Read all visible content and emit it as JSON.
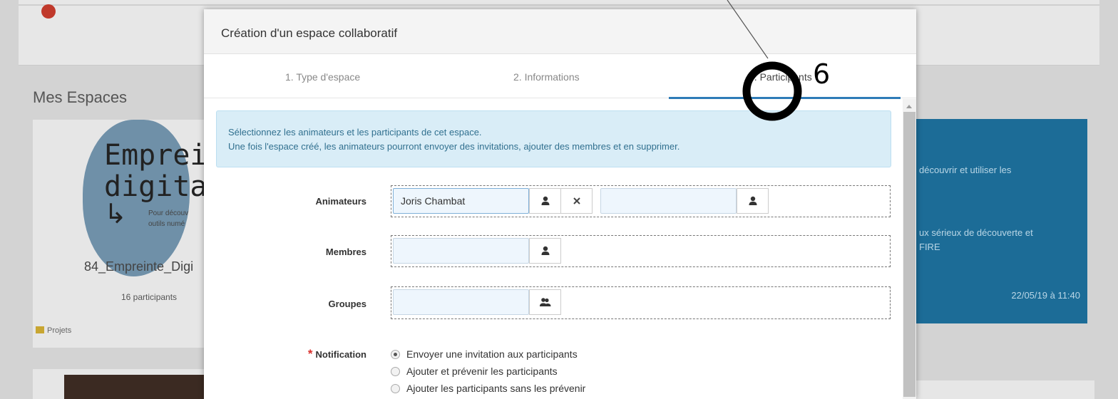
{
  "background": {
    "section_title": "Mes Espaces",
    "space_card": {
      "cover_line1": "Emprei",
      "cover_line2": "digita",
      "cover_arrow": "↳",
      "cover_small1": "Pour découv",
      "cover_small2": "outils numé",
      "name": "84_Empreinte_Digi",
      "participants": "16 participants",
      "projects_link": "Projets"
    },
    "right_card": {
      "text1": "découvrir et utiliser les",
      "text2": "ux sérieux de découverte et",
      "text3": "FIRE",
      "date": "22/05/19 à 11:40"
    }
  },
  "modal": {
    "title": "Création d'un espace collaboratif",
    "tabs": [
      {
        "label": "1. Type d'espace"
      },
      {
        "label": "2. Informations"
      },
      {
        "label": "3. Participants"
      }
    ],
    "info_line1": "Sélectionnez les animateurs et les participants de cet espace.",
    "info_line2": "Une fois l'espace créé, les animateurs pourront envoyer des invitations, ajouter des membres et en supprimer.",
    "animateurs": {
      "label": "Animateurs",
      "value": "Joris Chambat"
    },
    "membres": {
      "label": "Membres"
    },
    "groupes": {
      "label": "Groupes"
    },
    "notification": {
      "required_mark": "*",
      "label": "Notification",
      "options": [
        "Envoyer une invitation aux participants",
        "Ajouter et prévenir les participants",
        "Ajouter les participants sans les prévenir"
      ],
      "selected_index": 0
    }
  },
  "annotation": {
    "number": "6"
  },
  "colors": {
    "accent": "#2e7cb8",
    "info_bg": "#d9edf7",
    "info_text": "#31708f",
    "required": "#d9302c",
    "bg_card_blue": "#1c6c97"
  },
  "icons": {
    "user": "user-icon",
    "group": "group-icon",
    "clear": "close-icon"
  }
}
